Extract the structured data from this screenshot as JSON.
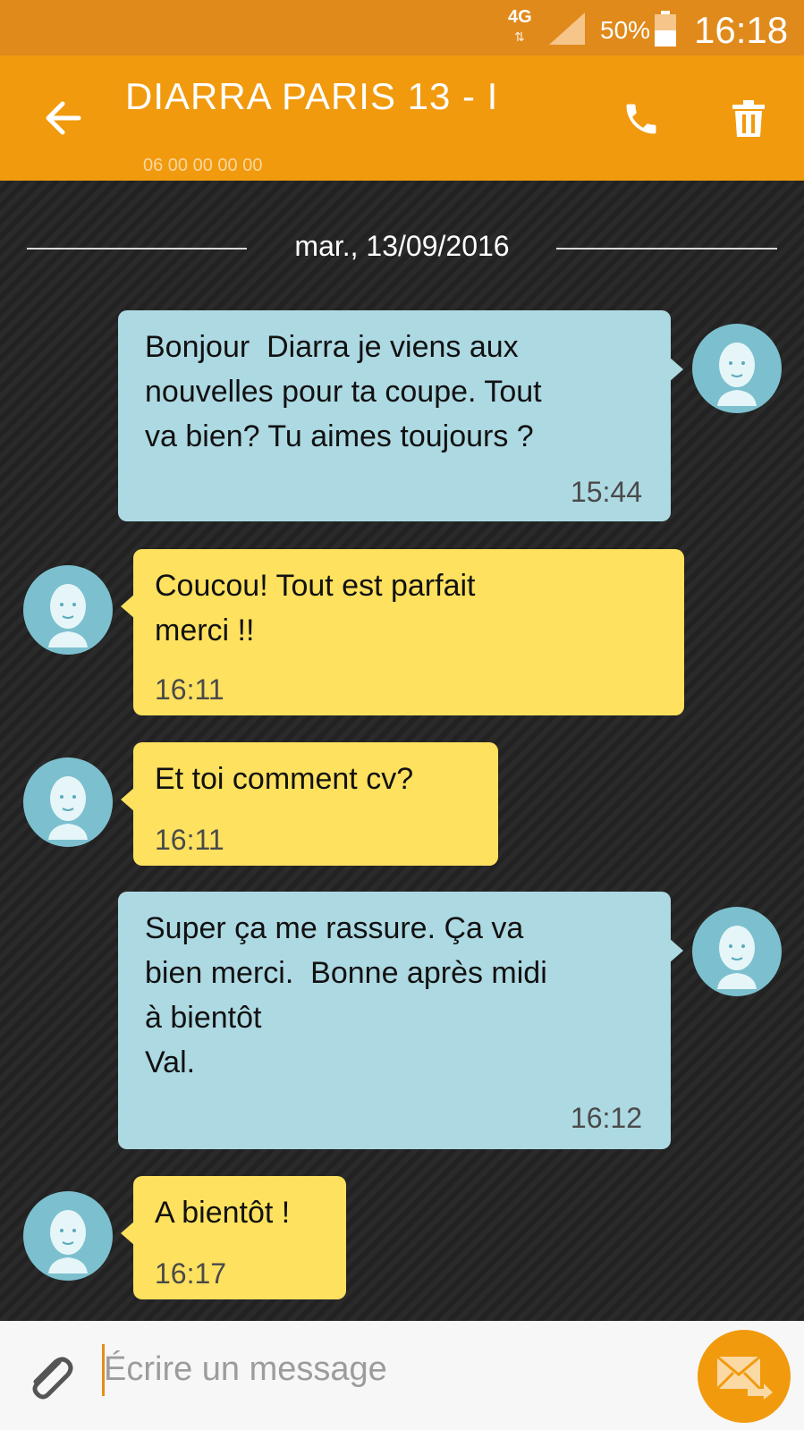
{
  "status_bar": {
    "network": "4G",
    "network_arrows": "⇅",
    "battery_percent": "50%",
    "battery_level": 0.5,
    "time": "16:18"
  },
  "app_bar": {
    "title": "DIARRA PARIS 13 - I",
    "subtitle": "06 00 00 00 00",
    "icons": [
      "back-arrow-icon",
      "phone-icon",
      "trash-icon"
    ]
  },
  "conversation": {
    "date": "mar., 13/09/2016",
    "messages": [
      {
        "direction": "out",
        "text": "Bonjour  Diarra je viens aux\nnouvelles pour ta coupe. Tout\nva bien? Tu aimes toujours ?",
        "time": "15:44"
      },
      {
        "direction": "in",
        "text": "Coucou! Tout est parfait\nmerci !!",
        "time": "16:11"
      },
      {
        "direction": "in",
        "text": "Et toi comment cv?",
        "time": "16:11"
      },
      {
        "direction": "out",
        "text": "Super ça me rassure. Ça va\nbien merci.  Bonne après midi\nà bientôt\nVal.",
        "time": "16:12"
      },
      {
        "direction": "in",
        "text": "A bientôt !",
        "time": "16:17"
      }
    ]
  },
  "composer": {
    "placeholder": "Écrire un message",
    "value": ""
  },
  "colors": {
    "status_bar": "#e08a1c",
    "app_bar": "#f19a0d",
    "outgoing_bubble": "#add9e2",
    "incoming_bubble": "#fde15f",
    "avatar": "#7cc0cf",
    "send_button": "#f19a0d"
  }
}
